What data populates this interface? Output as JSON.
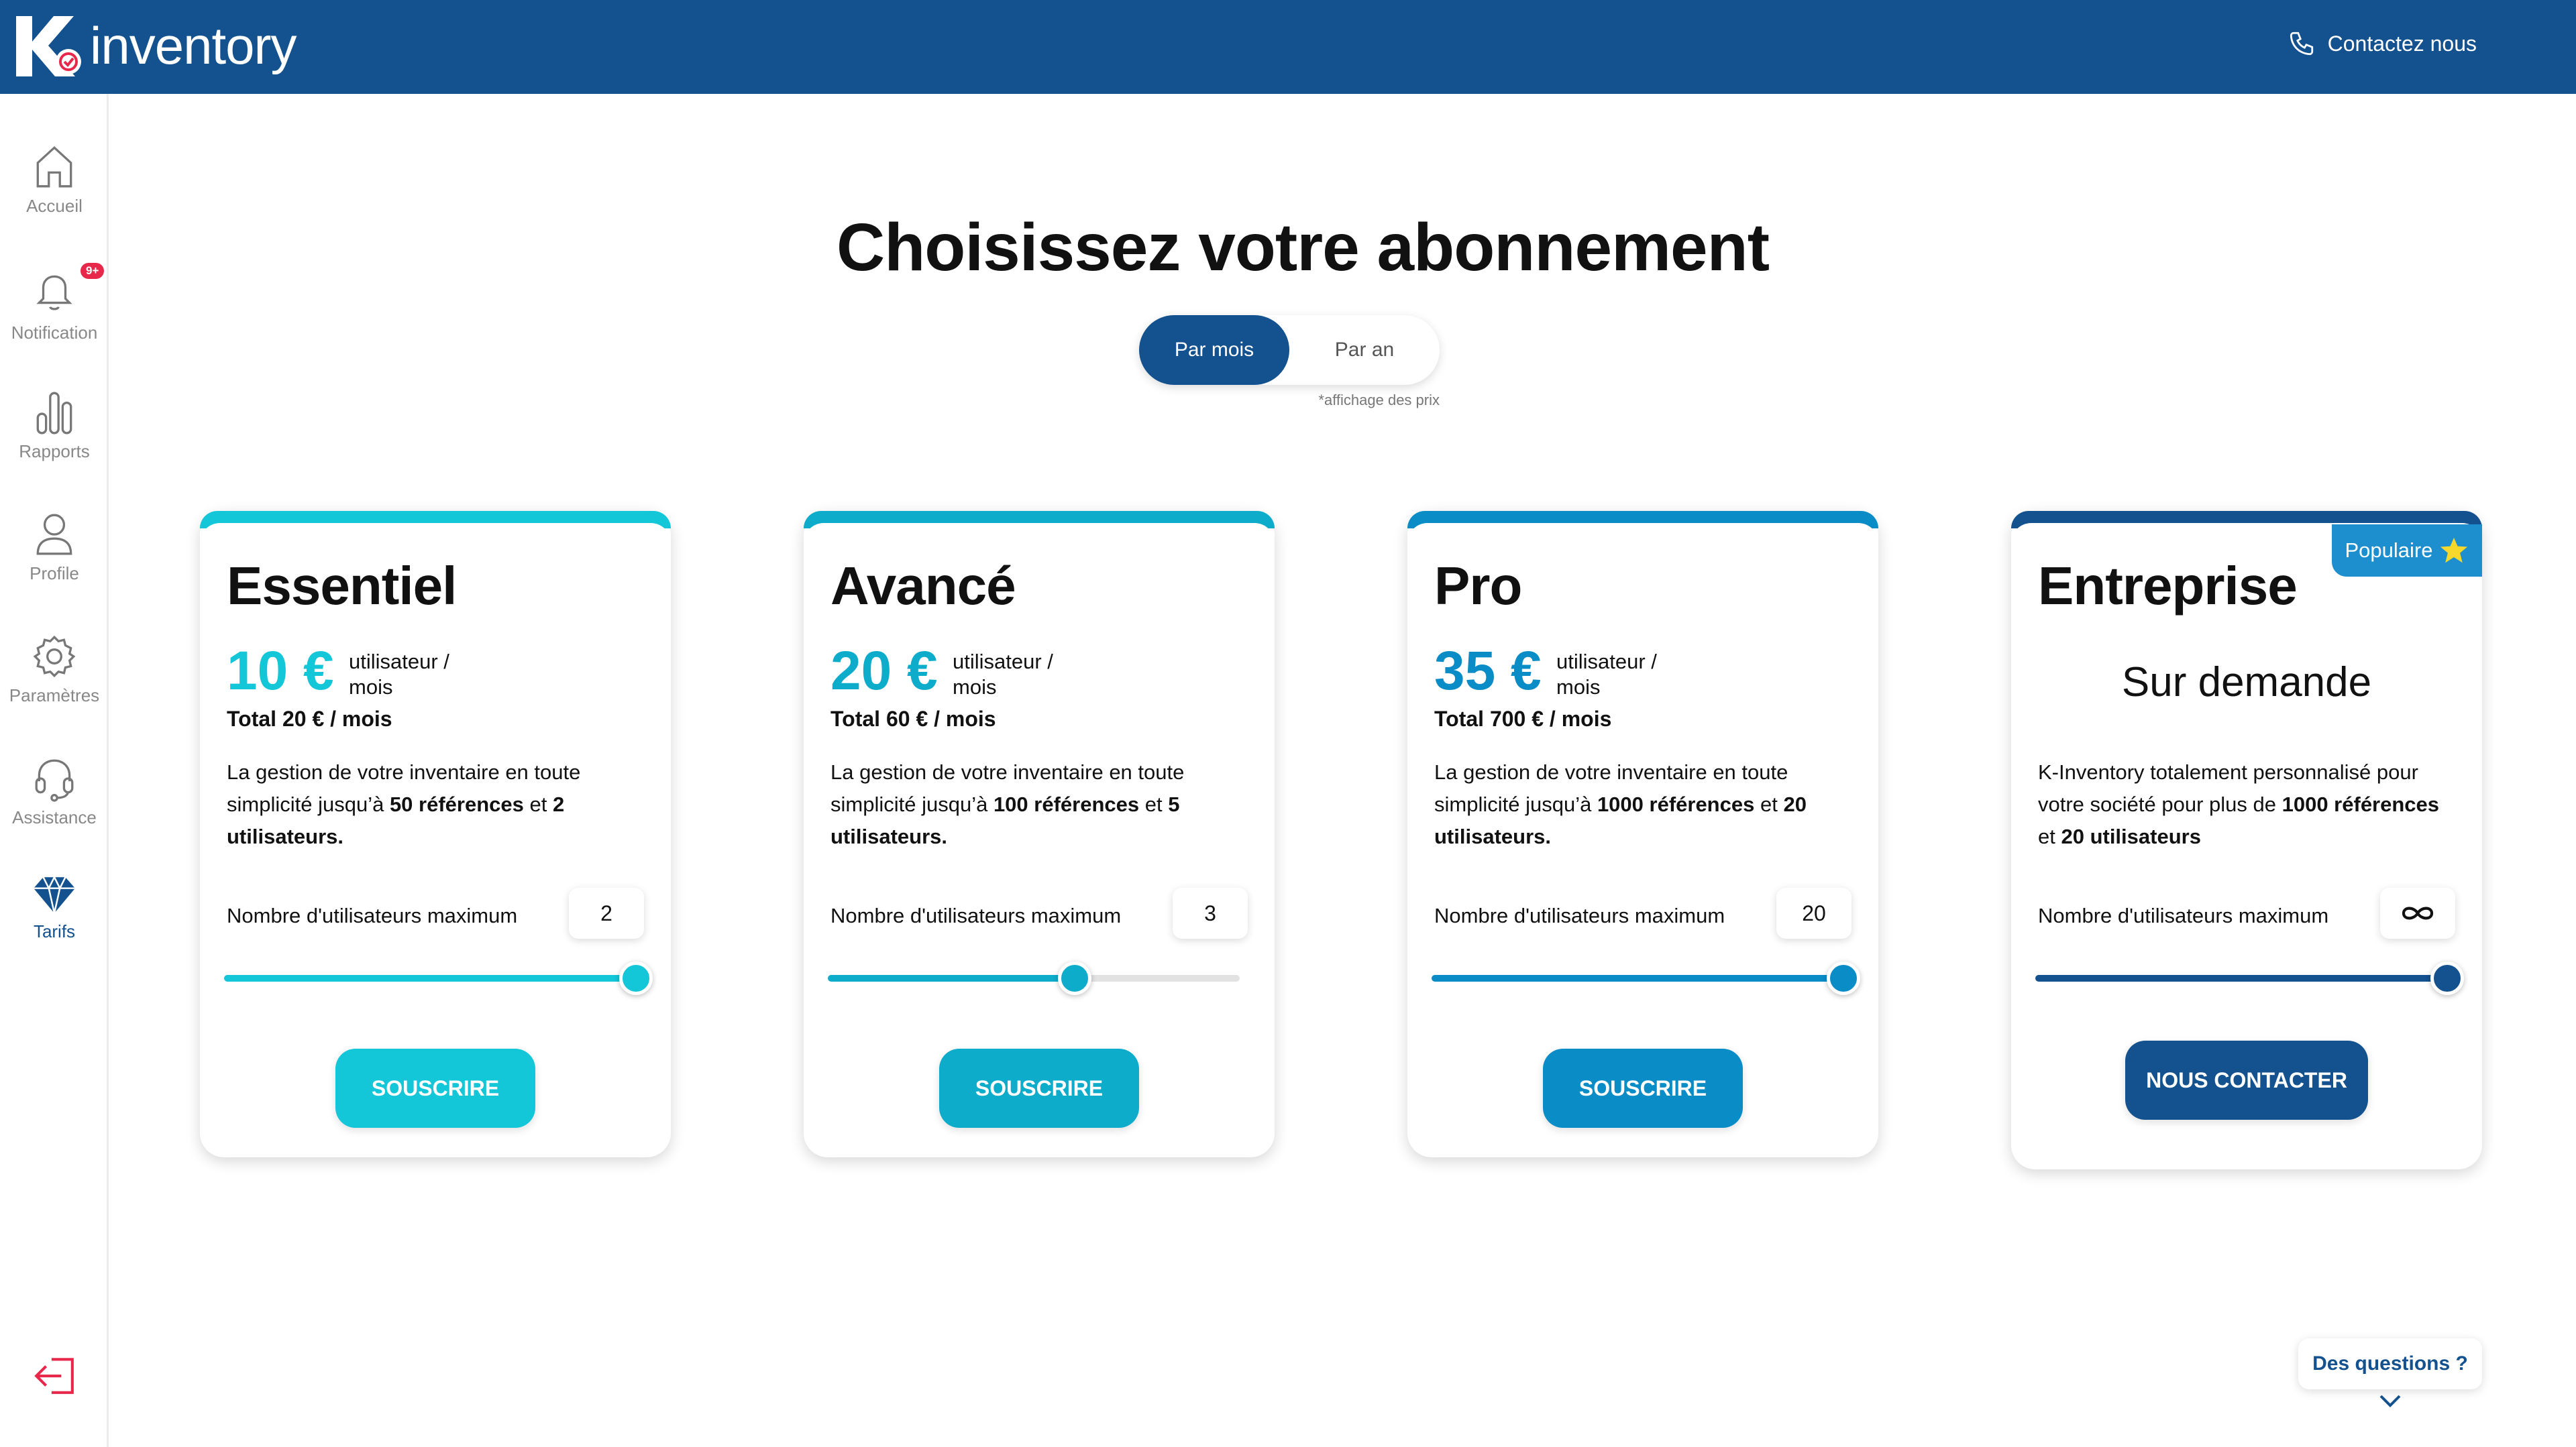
{
  "header": {
    "logo_text": "inventory",
    "contact_label": "Contactez nous"
  },
  "sidebar": {
    "items": [
      {
        "label": "Accueil",
        "icon": "home-icon"
      },
      {
        "label": "Notification",
        "icon": "bell-icon",
        "badge": "9+"
      },
      {
        "label": "Rapports",
        "icon": "bar-chart-icon"
      },
      {
        "label": "Profile",
        "icon": "user-icon"
      },
      {
        "label": "Paramètres",
        "icon": "gear-icon"
      },
      {
        "label": "Assistance",
        "icon": "headset-icon"
      },
      {
        "label": "Tarifs",
        "icon": "diamond-icon",
        "active": true
      }
    ],
    "logout_icon": "logout-icon"
  },
  "main": {
    "title": "Choisissez votre abonnement",
    "billing_toggle": {
      "monthly": "Par mois",
      "yearly": "Par an",
      "selected": "Par mois",
      "note": "*affichage des prix"
    }
  },
  "plans": [
    {
      "name": "Essentiel",
      "price": "10 €",
      "per_a": "utilisateur /",
      "per_b": "mois",
      "total": "Total 20 € / mois",
      "desc_1": "La gestion de votre inventaire en toute simplicité jusqu’à ",
      "desc_b1": "50 références",
      "desc_2": " et ",
      "desc_b2": "2 utilisateurs.",
      "users_label": "Nombre d'utilisateurs maximum",
      "users_value": "2",
      "slider_fraction": 1.0,
      "cta": "SOUSCRIRE",
      "color": "#13c6d8"
    },
    {
      "name": "Avancé",
      "price": "20 €",
      "per_a": "utilisateur /",
      "per_b": "mois",
      "total": "Total 60 € / mois",
      "desc_1": "La gestion de votre inventaire en toute simplicité jusqu’à ",
      "desc_b1": "100 références",
      "desc_2": " et ",
      "desc_b2": "5 utilisateurs.",
      "users_label": "Nombre d'utilisateurs maximum",
      "users_value": "3",
      "slider_fraction": 0.6,
      "cta": "SOUSCRIRE",
      "color": "#0daccb"
    },
    {
      "name": "Pro",
      "price": "35 €",
      "per_a": "utilisateur /",
      "per_b": "mois",
      "total": "Total 700 € / mois",
      "desc_1": "La gestion de votre inventaire en toute simplicité jusqu’à ",
      "desc_b1": "1000 références",
      "desc_2": " et ",
      "desc_b2": "20 utilisateurs.",
      "users_label": "Nombre d'utilisateurs maximum",
      "users_value": "20",
      "slider_fraction": 1.0,
      "cta": "SOUSCRIRE",
      "color": "#0a8cc7"
    },
    {
      "name": "Entreprise",
      "on_demand": "Sur demande",
      "badge": "Populaire",
      "desc_1": "K-Inventory totalement personnalisé pour votre société pour plus de ",
      "desc_b1": "1000 références",
      "desc_2": " et ",
      "desc_b2": "20 utilisateurs",
      "users_label": "Nombre d'utilisateurs maximum",
      "users_value_icon": "infinity-icon",
      "slider_fraction": 1.0,
      "cta": "NOUS CONTACTER",
      "color": "#13518f"
    }
  ],
  "faq": {
    "label": "Des questions ?"
  }
}
